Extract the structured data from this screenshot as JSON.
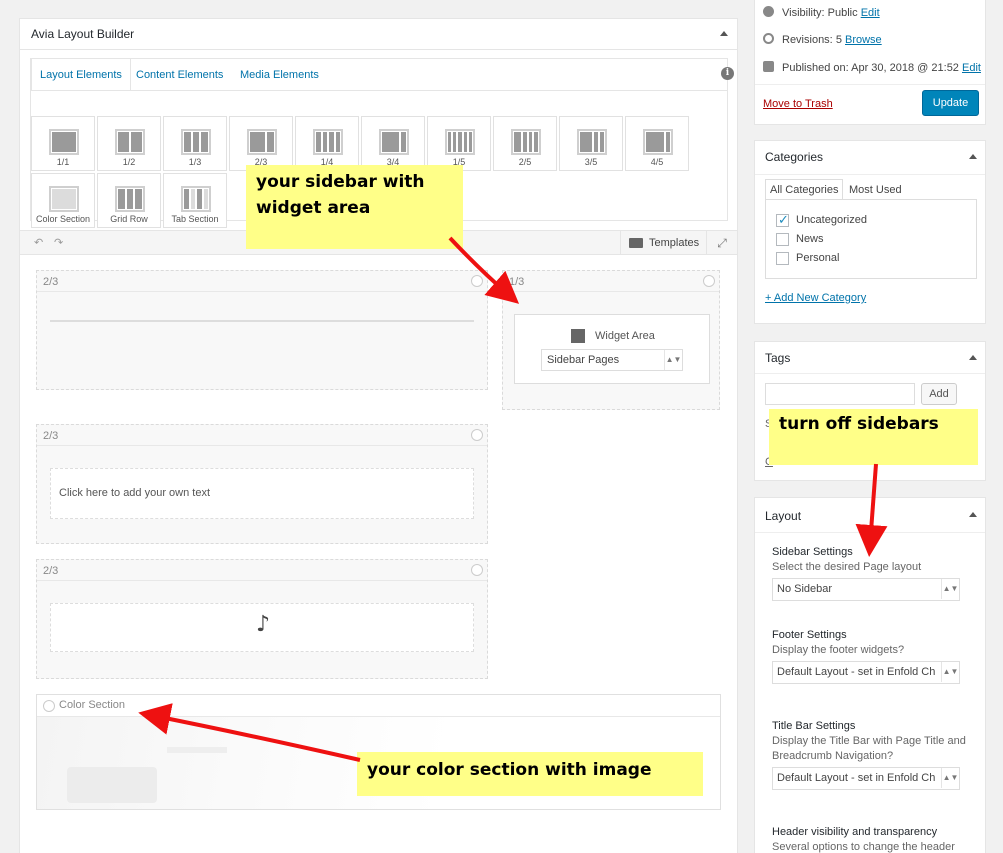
{
  "builder": {
    "title": "Avia Layout Builder",
    "tabs": [
      {
        "label": "Layout Elements"
      },
      {
        "label": "Content Elements"
      },
      {
        "label": "Media Elements"
      }
    ],
    "info_icon": "i",
    "elements": [
      {
        "label": "1/1"
      },
      {
        "label": "1/2"
      },
      {
        "label": "1/3"
      },
      {
        "label": "2/3"
      },
      {
        "label": "1/4"
      },
      {
        "label": "3/4"
      },
      {
        "label": "1/5"
      },
      {
        "label": "2/5"
      },
      {
        "label": "3/5"
      },
      {
        "label": "4/5"
      },
      {
        "label": "Color Section"
      },
      {
        "label": "Grid Row"
      },
      {
        "label": "Tab Section"
      }
    ],
    "undo_glyph": "↶",
    "redo_glyph": "↷",
    "templates_label": "Templates",
    "expand_glyph": "⤢",
    "canvas": {
      "block1_size": "2/3",
      "block2_size": "1/3",
      "widget_area_label": "Widget Area",
      "widget_select_value": "Sidebar Pages",
      "select_arrows": "▲▼",
      "block3_size": "2/3",
      "text_placeholder": "Click here to add your own text",
      "block4_size": "2/3",
      "audio_icon_glyph": "♪",
      "color_section_label": "Color Section"
    }
  },
  "publish": {
    "visibility_label": "Visibility:",
    "visibility_value": "Public",
    "visibility_edit": "Edit",
    "revisions_label": "Revisions:",
    "revisions_value": "5",
    "revisions_browse": "Browse",
    "published_label": "Published on:",
    "published_value": "Apr 30, 2018 @ 21:52",
    "published_edit": "Edit",
    "trash_label": "Move to Trash",
    "update_label": "Update"
  },
  "categories": {
    "title": "Categories",
    "tab_all": "All Categories",
    "tab_used": "Most Used",
    "items": [
      {
        "label": "Uncategorized",
        "checked": true
      },
      {
        "label": "News",
        "checked": false
      },
      {
        "label": "Personal",
        "checked": false
      }
    ],
    "check_glyph": "✓",
    "add_new": "+ Add New Category"
  },
  "tags": {
    "title": "Tags",
    "add_button": "Add",
    "hint_partial": "S",
    "link_partial": "C"
  },
  "layout": {
    "title": "Layout",
    "sidebar_heading": "Sidebar Settings",
    "sidebar_desc": "Select the desired Page layout",
    "sidebar_value": "No Sidebar",
    "footer_heading": "Footer Settings",
    "footer_desc": "Display the footer widgets?",
    "footer_value": "Default Layout - set in Enfold Ch",
    "titlebar_heading": "Title Bar Settings",
    "titlebar_desc": "Display the Title Bar with Page Title and Breadcrumb Navigation?",
    "titlebar_value": "Default Layout - set in Enfold Ch",
    "header_heading": "Header visibility and transparency",
    "header_desc": "Several options to change the header"
  },
  "annotations": {
    "sidebar_note": "your sidebar with widget area",
    "turnoff_note": "turn off sidebars",
    "colorsection_note": "your color section with image",
    "arrow_color": "#ee1111"
  }
}
